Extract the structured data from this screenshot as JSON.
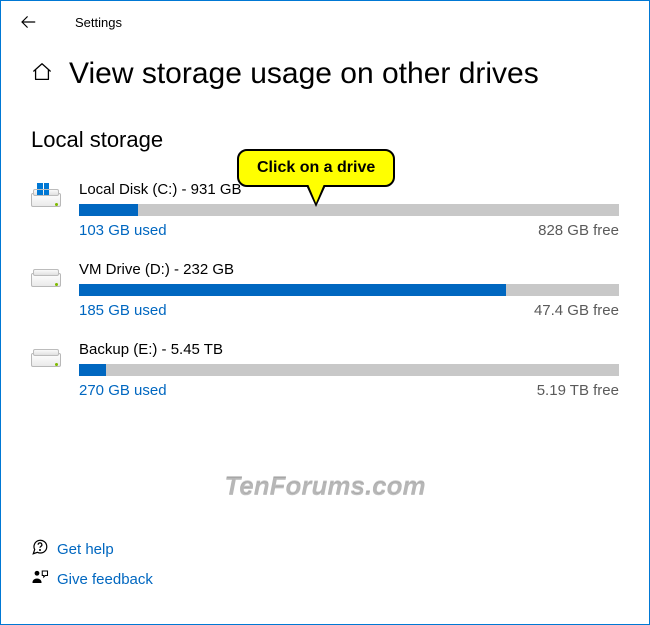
{
  "app": {
    "name": "Settings",
    "page_title": "View storage usage on other drives"
  },
  "section": {
    "title": "Local storage"
  },
  "callout": {
    "text": "Click on a drive"
  },
  "drives": [
    {
      "title": "Local Disk (C:) - 931 GB",
      "used": "103 GB used",
      "free": "828 GB free",
      "fill_percent": 11,
      "system": true
    },
    {
      "title": "VM Drive (D:) - 232 GB",
      "used": "185 GB used",
      "free": "47.4 GB free",
      "fill_percent": 79,
      "system": false
    },
    {
      "title": "Backup (E:) - 5.45 TB",
      "used": "270 GB used",
      "free": "5.19 TB free",
      "fill_percent": 5,
      "system": false
    }
  ],
  "footer": {
    "help": "Get help",
    "feedback": "Give feedback"
  },
  "watermark": "TenForums.com"
}
